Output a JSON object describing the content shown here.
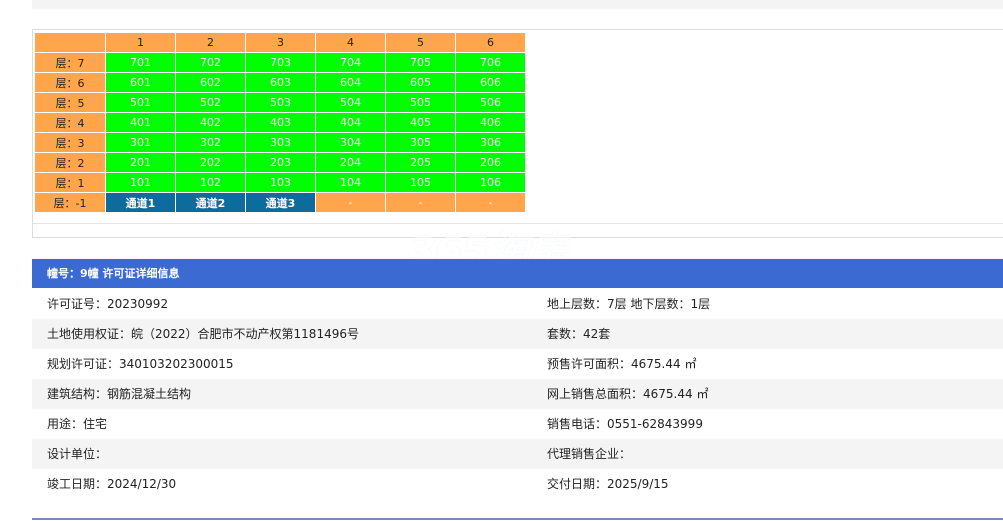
{
  "grid": {
    "columns": [
      "1",
      "2",
      "3",
      "4",
      "5",
      "6"
    ],
    "rows": [
      {
        "floor": "层：7",
        "units": [
          "701",
          "702",
          "703",
          "704",
          "705",
          "706"
        ]
      },
      {
        "floor": "层：6",
        "units": [
          "601",
          "602",
          "603",
          "604",
          "605",
          "606"
        ]
      },
      {
        "floor": "层：5",
        "units": [
          "501",
          "502",
          "503",
          "504",
          "505",
          "506"
        ]
      },
      {
        "floor": "层：4",
        "units": [
          "401",
          "402",
          "403",
          "404",
          "405",
          "406"
        ]
      },
      {
        "floor": "层：3",
        "units": [
          "301",
          "302",
          "303",
          "304",
          "305",
          "306"
        ]
      },
      {
        "floor": "层：2",
        "units": [
          "201",
          "202",
          "203",
          "204",
          "205",
          "206"
        ]
      },
      {
        "floor": "层：1",
        "units": [
          "101",
          "102",
          "103",
          "104",
          "105",
          "106"
        ]
      }
    ],
    "basement": {
      "floor": "层：-1",
      "cells": [
        "通道1",
        "通道2",
        "通道3",
        "-",
        "-",
        "-"
      ]
    },
    "colors": {
      "header": "#ffa54c",
      "unit_available": "#00ff00",
      "passage": "#0e6c9c"
    }
  },
  "watermark": {
    "logo": "365淘房",
    "url": "www.house365.com"
  },
  "info": {
    "header": "幢号：9幢 许可证详细信息",
    "rows": [
      {
        "left": "许可证号：20230992",
        "right": "地上层数：7层  地下层数：1层"
      },
      {
        "left": "土地使用权证：皖（2022）合肥市不动产权第1181496号",
        "right": "套数：42套"
      },
      {
        "left": "规划许可证：340103202300015",
        "right": "预售许可面积：4675.44 ㎡"
      },
      {
        "left": "建筑结构：钢筋混凝土结构",
        "right": "网上销售总面积：4675.44 ㎡"
      },
      {
        "left": "用途：住宅",
        "right": "销售电话：0551-62843999"
      },
      {
        "left": "设计单位：",
        "right": "代理销售企业："
      },
      {
        "left": "竣工日期：2024/12/30",
        "right": "交付日期：2025/9/15"
      }
    ]
  }
}
